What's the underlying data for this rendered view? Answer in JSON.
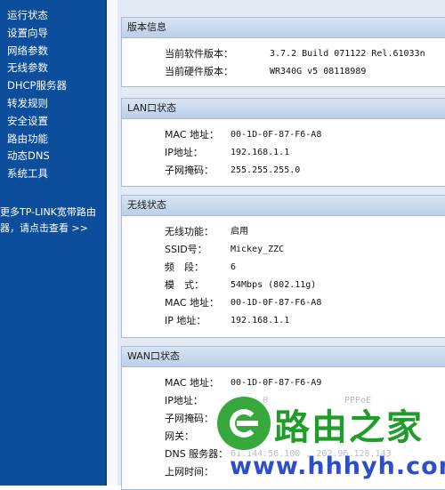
{
  "sidebar": {
    "items": [
      {
        "label": "运行状态"
      },
      {
        "label": "设置向导"
      },
      {
        "label": "网络参数"
      },
      {
        "label": "无线参数"
      },
      {
        "label": "DHCP服务器"
      },
      {
        "label": "转发规则"
      },
      {
        "label": "安全设置"
      },
      {
        "label": "路由功能"
      },
      {
        "label": "动态DNS"
      },
      {
        "label": "系统工具"
      }
    ],
    "promo_line1": "更多TP-LINK宽带路由",
    "promo_line2": "器，请点击查看 >>"
  },
  "version_info": {
    "title": "版本信息",
    "rows": [
      {
        "label": "当前软件版本：",
        "value": "3.7.2 Build 071122 Rel.61033n"
      },
      {
        "label": "当前硬件版本：",
        "value": "WR340G v5 08118989"
      }
    ]
  },
  "lan_status": {
    "title": "LAN口状态",
    "rows": [
      {
        "label": "MAC 地址：",
        "value": "00-1D-0F-87-F6-A8"
      },
      {
        "label": "IP地址：",
        "value": "192.168.1.1"
      },
      {
        "label": "子网掩码：",
        "value": "255.255.255.0"
      }
    ]
  },
  "wireless_status": {
    "title": "无线状态",
    "rows": [
      {
        "label": "无线功能：",
        "value": "启用"
      },
      {
        "label": "SSID号：",
        "value": "Mickey_ZZC"
      },
      {
        "label": "频　段：",
        "value": "6"
      },
      {
        "label": "模　式：",
        "value": "54Mbps (802.11g)"
      },
      {
        "label": "MAC 地址：",
        "value": "00-1D-0F-87-F6-A8"
      },
      {
        "label": "IP 地址：",
        "value": "192.168.1.1"
      }
    ]
  },
  "wan_status": {
    "title": "WAN口状态",
    "rows": [
      {
        "label": "MAC 地址：",
        "value": "00-1D-0F-87-F6-A9"
      },
      {
        "label": "IP地址：",
        "value": "0.0.0.0"
      },
      {
        "label": "子网掩码：",
        "value": ""
      },
      {
        "label": "网关：",
        "value": ""
      },
      {
        "label": "DNS 服务器：",
        "value": "61.144.56.100 , 202.96.128.143"
      },
      {
        "label": "上网时间：",
        "value": ""
      }
    ],
    "connection_type": "PPPoE"
  },
  "watermark": {
    "title": "路由之家",
    "url": "www.hhhyh.com"
  },
  "colors": {
    "sidebar_bg": "#0d4e9c",
    "panel_header": "#c6d6ec",
    "watermark_green": "#1f9d2a",
    "watermark_blue": "#2b4fc9"
  }
}
